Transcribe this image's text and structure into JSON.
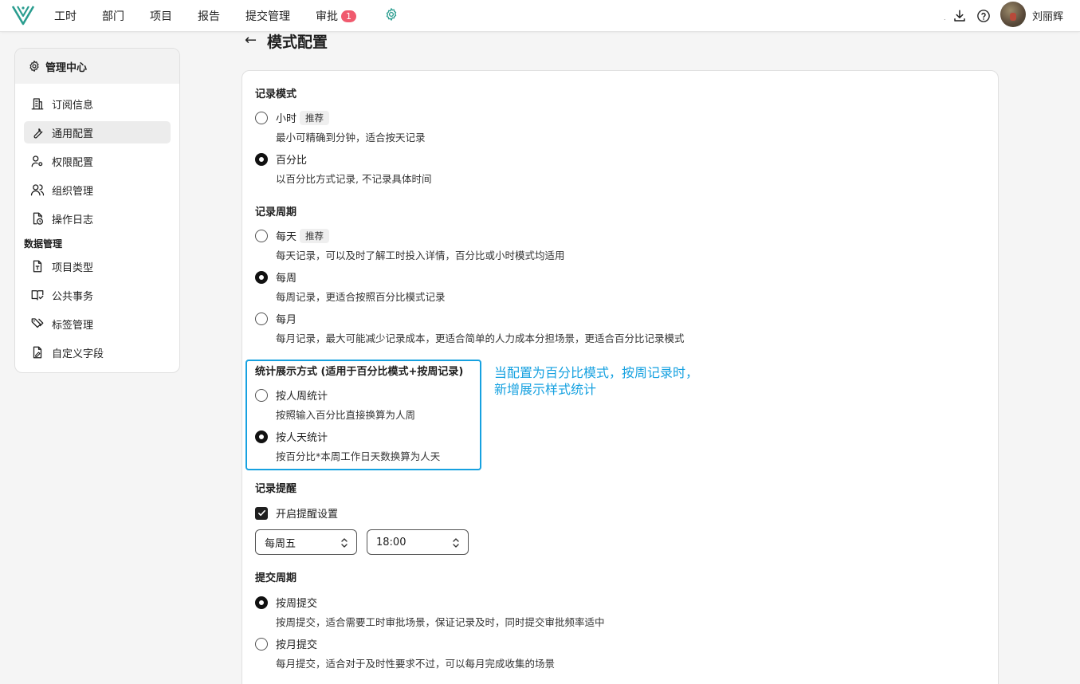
{
  "nav": {
    "items": [
      "工时",
      "部门",
      "项目",
      "报告",
      "提交管理"
    ],
    "approval_label": "审批",
    "approval_count": "1",
    "dot": ".",
    "username": "刘丽辉"
  },
  "sidebar": {
    "title": "管理中心",
    "items": [
      {
        "label": "订阅信息",
        "icon": "building-icon"
      },
      {
        "label": "通用配置",
        "icon": "wrench-icon",
        "active": true
      },
      {
        "label": "权限配置",
        "icon": "user-key-icon"
      },
      {
        "label": "组织管理",
        "icon": "users-icon"
      },
      {
        "label": "操作日志",
        "icon": "file-clock-icon"
      }
    ],
    "group_label": "数据管理",
    "group_items": [
      {
        "label": "项目类型",
        "icon": "file-type-icon"
      },
      {
        "label": "公共事务",
        "icon": "book-check-icon"
      },
      {
        "label": "标签管理",
        "icon": "tags-icon"
      },
      {
        "label": "自定义字段",
        "icon": "file-edit-icon"
      }
    ]
  },
  "page": {
    "back": "←",
    "title": "模式配置"
  },
  "sections": {
    "record_mode": {
      "title": "记录模式",
      "options": [
        {
          "label": "小时",
          "tag": "推荐",
          "desc": "最小可精确到分钟，适合按天记录",
          "checked": false
        },
        {
          "label": "百分比",
          "desc": "以百分比方式记录, 不记录具体时间",
          "checked": true
        }
      ]
    },
    "record_period": {
      "title": "记录周期",
      "options": [
        {
          "label": "每天",
          "tag": "推荐",
          "desc": "每天记录，可以及时了解工时投入详情，百分比或小时模式均适用",
          "checked": false
        },
        {
          "label": "每周",
          "desc": "每周记录，更适合按照百分比模式记录",
          "checked": true
        },
        {
          "label": "每月",
          "desc": "每月记录，最大可能减少记录成本，更适合简单的人力成本分担场景，更适合百分比记录模式",
          "checked": false
        }
      ]
    },
    "stat_display": {
      "title": "统计展示方式 (适用于百分比模式+按周记录)",
      "options": [
        {
          "label": "按人周统计",
          "desc": "按照输入百分比直接换算为人周",
          "checked": false
        },
        {
          "label": "按人天统计",
          "desc": "按百分比*本周工作日天数换算为人天",
          "checked": true
        }
      ],
      "annotation_line1": "当配置为百分比模式，按周记录时，",
      "annotation_line2": "新增展示样式统计",
      "highlight_color": "#16a1e0"
    },
    "reminder": {
      "title": "记录提醒",
      "checkbox_label": "开启提醒设置",
      "checked": true,
      "day_value": "每周五",
      "time_value": "18:00"
    },
    "submit_period": {
      "title": "提交周期",
      "options": [
        {
          "label": "按周提交",
          "desc": "按周提交，适合需要工时审批场景，保证记录及时，同时提交审批频率适中",
          "checked": true
        },
        {
          "label": "按月提交",
          "desc": "每月提交，适合对于及时性要求不过，可以每月完成收集的场景",
          "checked": false
        }
      ]
    }
  }
}
